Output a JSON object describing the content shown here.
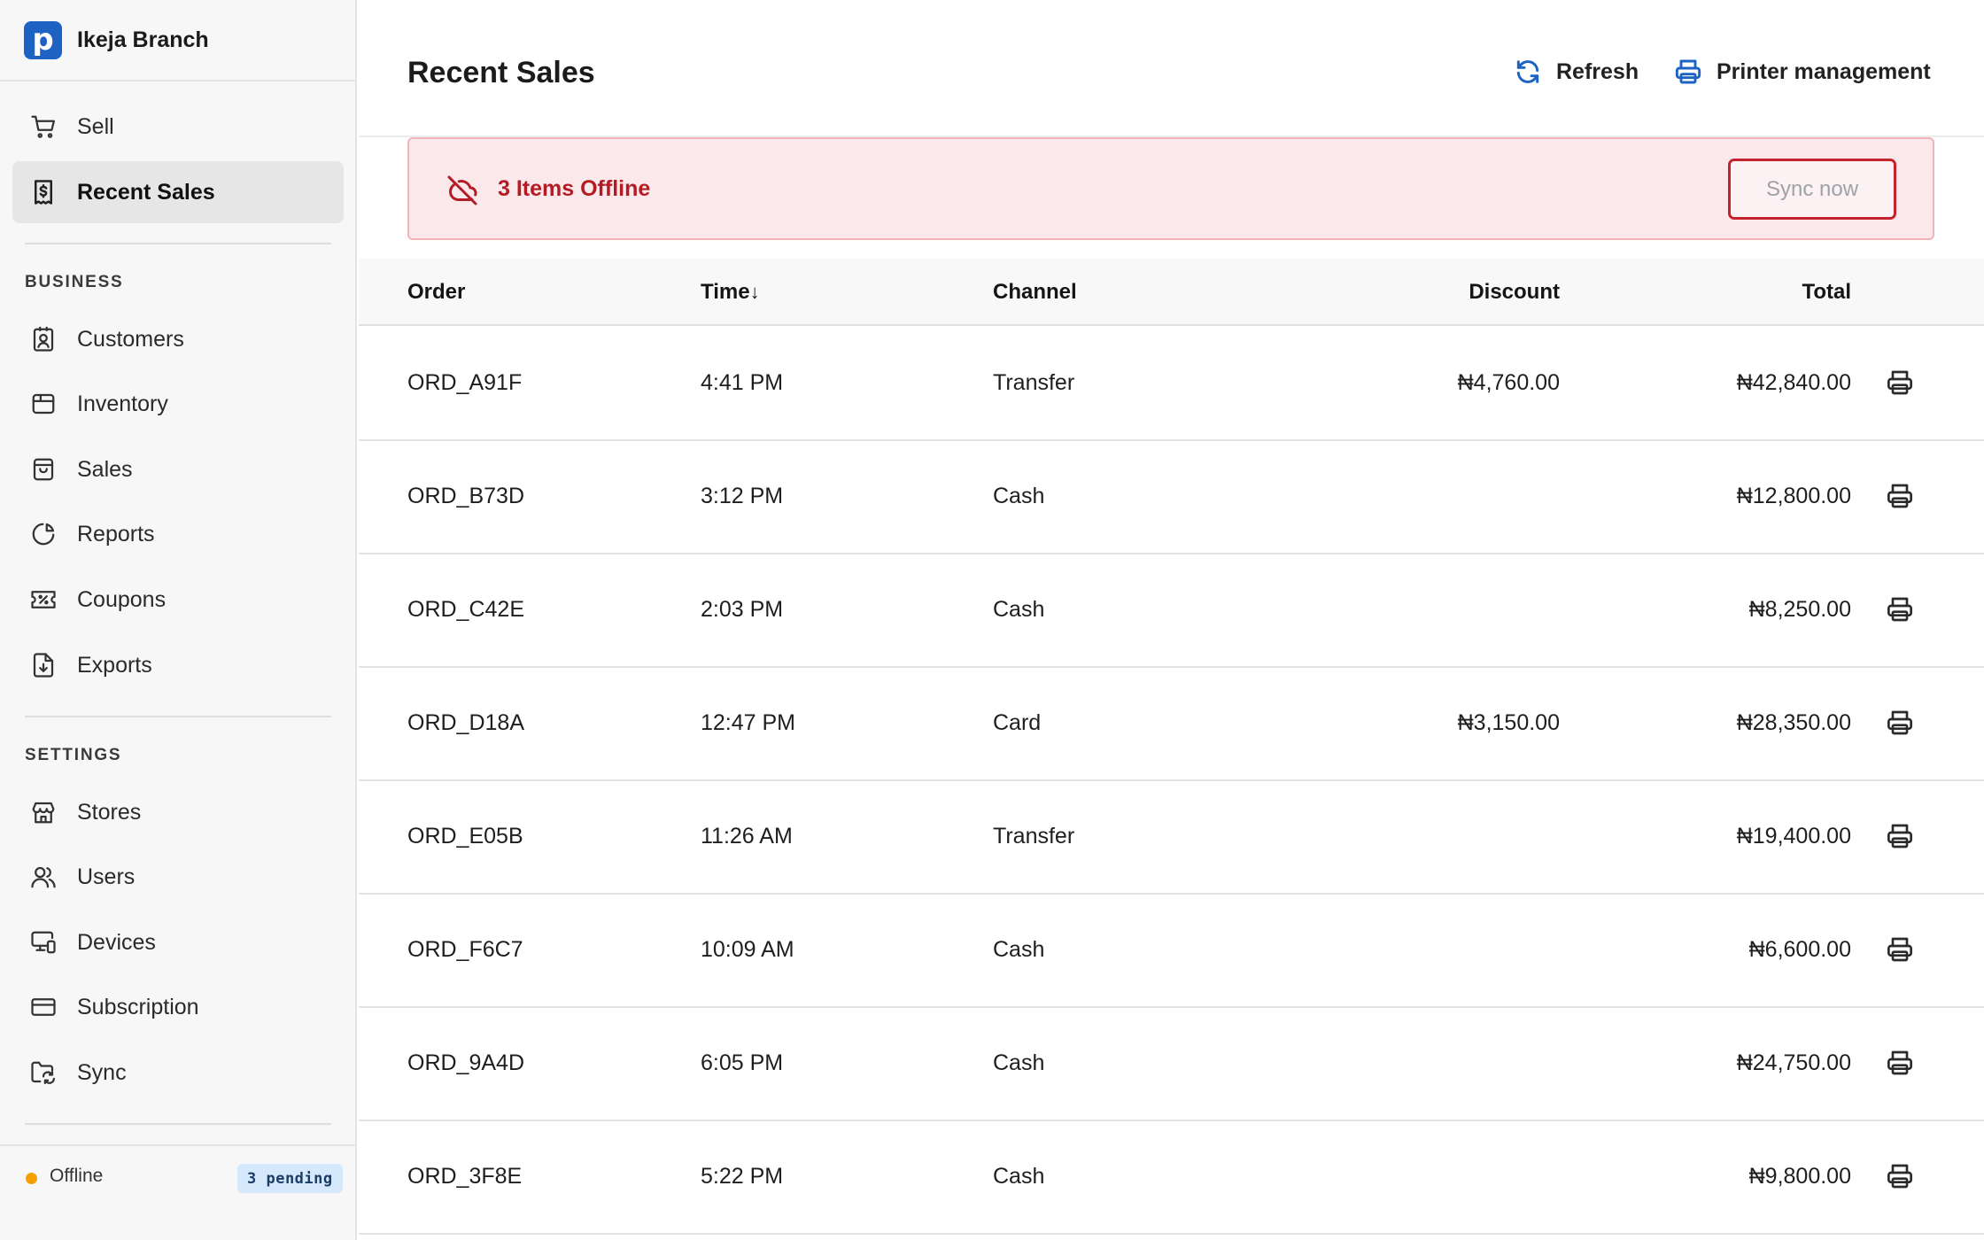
{
  "app": {
    "brand_letter": "p",
    "branch_name": "Ikeja Branch",
    "accent_color": "#1e63c4"
  },
  "sidebar": {
    "top_items": [
      {
        "label": "Sell",
        "icon": "cart-icon",
        "active": false
      },
      {
        "label": "Recent Sales",
        "icon": "receipt-dollar-icon",
        "active": true
      }
    ],
    "business_title": "BUSINESS",
    "business_items": [
      {
        "label": "Customers",
        "icon": "contact-card-icon"
      },
      {
        "label": "Inventory",
        "icon": "box-icon"
      },
      {
        "label": "Sales",
        "icon": "shopping-bag-icon"
      },
      {
        "label": "Reports",
        "icon": "pie-chart-icon"
      },
      {
        "label": "Coupons",
        "icon": "ticket-percent-icon"
      },
      {
        "label": "Exports",
        "icon": "file-download-icon"
      }
    ],
    "settings_title": "SETTINGS",
    "settings_items": [
      {
        "label": "Stores",
        "icon": "store-icon"
      },
      {
        "label": "Users",
        "icon": "users-icon"
      },
      {
        "label": "Devices",
        "icon": "devices-icon"
      },
      {
        "label": "Subscription",
        "icon": "credit-card-icon"
      },
      {
        "label": "Sync",
        "icon": "folder-sync-icon"
      }
    ],
    "footer": {
      "status": "Offline",
      "status_color": "#f5a000",
      "pending_badge": "3 pending"
    }
  },
  "header": {
    "title": "Recent Sales",
    "refresh_label": "Refresh",
    "printer_label": "Printer management"
  },
  "banner": {
    "message": "3 Items Offline",
    "sync_label": "Sync now",
    "color": "#b31b25"
  },
  "table": {
    "columns": {
      "order": "Order",
      "time": "Time",
      "channel": "Channel",
      "discount": "Discount",
      "total": "Total"
    },
    "sort_indicator": "↓",
    "rows": [
      {
        "order": "ORD_A91F",
        "time": "4:41 PM",
        "channel": "Transfer",
        "discount": "₦4,760.00",
        "total": "₦42,840.00"
      },
      {
        "order": "ORD_B73D",
        "time": "3:12 PM",
        "channel": "Cash",
        "discount": "",
        "total": "₦12,800.00"
      },
      {
        "order": "ORD_C42E",
        "time": "2:03 PM",
        "channel": "Cash",
        "discount": "",
        "total": "₦8,250.00"
      },
      {
        "order": "ORD_D18A",
        "time": "12:47 PM",
        "channel": "Card",
        "discount": "₦3,150.00",
        "total": "₦28,350.00"
      },
      {
        "order": "ORD_E05B",
        "time": "11:26 AM",
        "channel": "Transfer",
        "discount": "",
        "total": "₦19,400.00"
      },
      {
        "order": "ORD_F6C7",
        "time": "10:09 AM",
        "channel": "Cash",
        "discount": "",
        "total": "₦6,600.00"
      },
      {
        "order": "ORD_9A4D",
        "time": "6:05 PM",
        "channel": "Cash",
        "discount": "",
        "total": "₦24,750.00"
      },
      {
        "order": "ORD_3F8E",
        "time": "5:22 PM",
        "channel": "Cash",
        "discount": "",
        "total": "₦9,800.00"
      }
    ]
  }
}
